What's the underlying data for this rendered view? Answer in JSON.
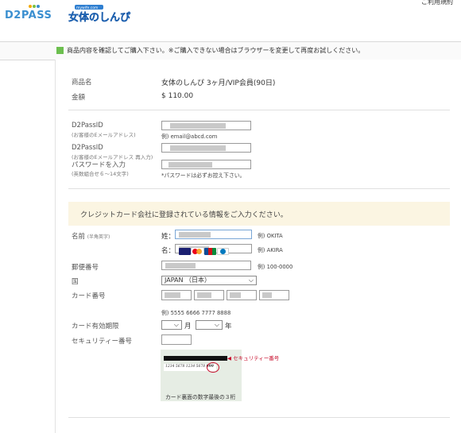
{
  "header": {
    "logo_text": "D2PASS",
    "brand_caption": "mywife.com",
    "brand_text": "女体のしんぴ",
    "top_right_text": "ご利用規約"
  },
  "notice": {
    "text": "商品内容を確認してご購入下さい。※ご購入できない場合はブラウザーを変更して再度お試しください。"
  },
  "product": {
    "name_label": "商品名",
    "name_value": "女体のしんぴ 3ヶ月/VIP会員(90日)",
    "price_label": "金額",
    "price_value": "$ 110.00"
  },
  "account": {
    "id_label": "D2PassID",
    "id_sub": "(お客様のEメールアドレス)",
    "id_hint": "例) email@abcd.com",
    "id_confirm_label": "D2PassID",
    "id_confirm_sub": "(お客様のEメールアドレス 再入力)",
    "password_label": "パスワードを入力",
    "password_sub": "(英数組合せ６～14文字)",
    "password_hint": "*パスワードは必ずお控え下さい。"
  },
  "card_section": {
    "banner": "クレジットカード会社に登録されている情報をご入力ください。",
    "name_label": "名前",
    "name_sub": "(半角英字)",
    "last_name_prefix": "姓：",
    "last_name_hint": "例) OKITA",
    "first_name_prefix": "名：",
    "first_name_hint": "例) AKIRA",
    "postal_label": "郵便番号",
    "postal_hint": "例) 100-0000",
    "country_label": "国",
    "country_value": "JAPAN （日本）",
    "card_number_label": "カード番号",
    "card_number_hint": "例) 5555 6666 7777 8888",
    "expiry_label": "カード有効期限",
    "expiry_month_unit": "月",
    "expiry_year_unit": "年",
    "security_label": "セキュリティー番号",
    "cvv_sample_digits": "1234 5678 1234 5678",
    "cvv_sample_code": "999",
    "cvv_callout": "セキュリティー番号",
    "cvv_caption": "カード裏面の数字最後の３桁"
  },
  "card_brands": [
    "VISA",
    "MasterCard",
    "JCB",
    "Diners Club"
  ],
  "colors": {
    "accent_green": "#6cbf4f",
    "banner_bg": "#fbf5e2",
    "logo_blue": "#3b8fd0",
    "cvv_red": "#c8102e"
  }
}
